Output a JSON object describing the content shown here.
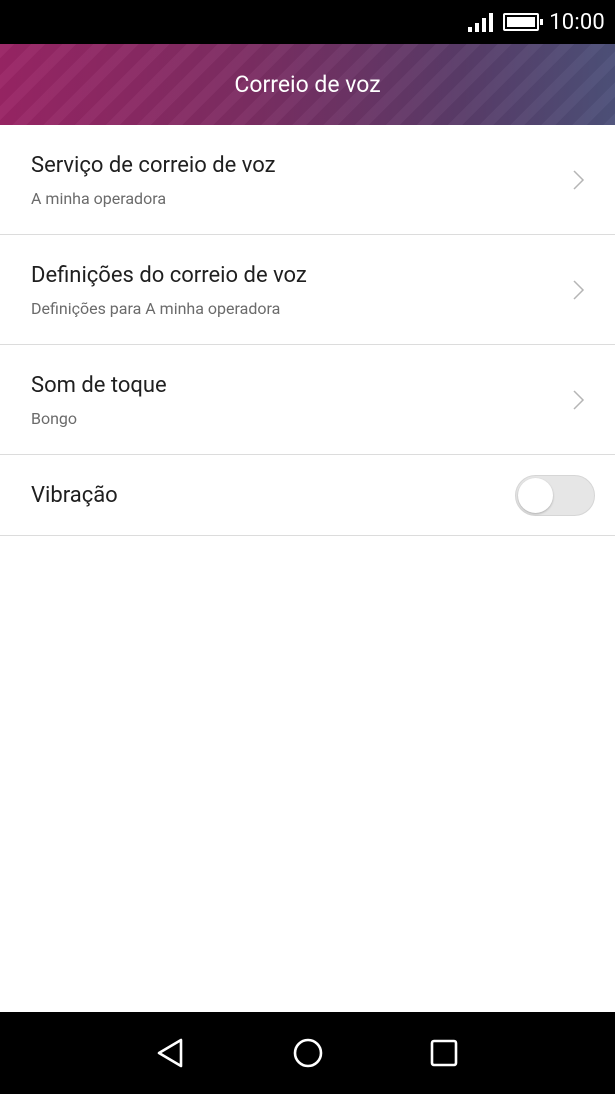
{
  "status_bar": {
    "time": "10:00",
    "icons": [
      "signal-icon",
      "battery-icon"
    ]
  },
  "app_bar": {
    "title": "Correio de voz",
    "colors": {
      "start": "#9a2565",
      "end": "#4d517a"
    }
  },
  "settings": {
    "items": [
      {
        "title": "Serviço de correio de voz",
        "subtitle": "A minha operadora",
        "icon": "chevron-right-icon"
      },
      {
        "title": "Definições do correio de voz",
        "subtitle": "Definições para A minha operadora",
        "icon": "chevron-right-icon"
      },
      {
        "title": "Som de toque",
        "subtitle": "Bongo",
        "icon": "chevron-right-icon"
      }
    ],
    "vibration": {
      "title": "Vibração",
      "enabled": false
    }
  },
  "nav_bar": {
    "buttons": [
      "back-icon",
      "home-icon",
      "recents-icon"
    ]
  }
}
